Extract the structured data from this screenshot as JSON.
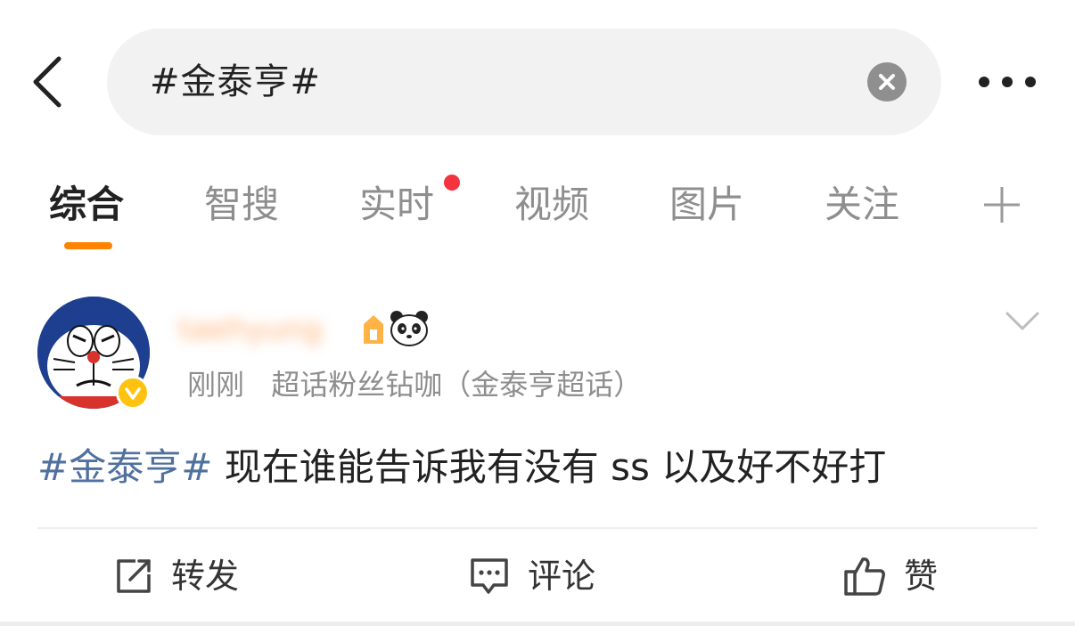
{
  "header": {
    "search_value": "#金泰亨#",
    "back_icon": "chevron-left-icon",
    "clear_icon": "clear-circle-icon",
    "more_icon": "more-horizontal-icon"
  },
  "tabs": [
    {
      "label": "综合",
      "active": true
    },
    {
      "label": "智搜",
      "active": false
    },
    {
      "label": "实时",
      "active": false,
      "has_dot": true
    },
    {
      "label": "视频",
      "active": false
    },
    {
      "label": "图片",
      "active": false
    },
    {
      "label": "关注",
      "active": false
    }
  ],
  "post": {
    "username": "taehyung",
    "time": "刚刚",
    "source": "超话粉丝钻咖（金泰亨超话）",
    "hashtag": "#金泰亨#",
    "text": " 现在谁能告诉我有没有 ss 以及好不好打"
  },
  "actions": {
    "repost": "转发",
    "comment": "评论",
    "like": "赞"
  },
  "colors": {
    "accent": "#ff8200",
    "hashtag": "#50709e",
    "notification_dot": "#f5333f",
    "verified_badge": "#ffc20e"
  }
}
